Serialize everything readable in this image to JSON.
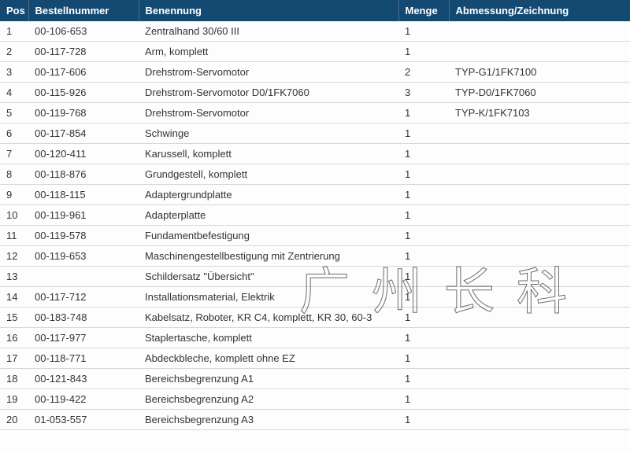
{
  "watermark": "广州长科",
  "columns": {
    "pos": "Pos",
    "bestellnummer": "Bestellnummer",
    "benennung": "Benennung",
    "menge": "Menge",
    "abmessung": "Abmessung/Zeichnung"
  },
  "rows": [
    {
      "pos": "1",
      "bestellnummer": "00-106-653",
      "benennung": "Zentralhand 30/60 III",
      "menge": "1",
      "abmessung": ""
    },
    {
      "pos": "2",
      "bestellnummer": "00-117-728",
      "benennung": "Arm, komplett",
      "menge": "1",
      "abmessung": ""
    },
    {
      "pos": "3",
      "bestellnummer": "00-117-606",
      "benennung": "Drehstrom-Servomotor",
      "menge": "2",
      "abmessung": "TYP-G1/1FK7100"
    },
    {
      "pos": "4",
      "bestellnummer": "00-115-926",
      "benennung": "Drehstrom-Servomotor D0/1FK7060",
      "menge": "3",
      "abmessung": "TYP-D0/1FK7060"
    },
    {
      "pos": "5",
      "bestellnummer": "00-119-768",
      "benennung": "Drehstrom-Servomotor",
      "menge": "1",
      "abmessung": "TYP-K/1FK7103"
    },
    {
      "pos": "6",
      "bestellnummer": "00-117-854",
      "benennung": "Schwinge",
      "menge": "1",
      "abmessung": ""
    },
    {
      "pos": "7",
      "bestellnummer": "00-120-411",
      "benennung": "Karussell, komplett",
      "menge": "1",
      "abmessung": ""
    },
    {
      "pos": "8",
      "bestellnummer": "00-118-876",
      "benennung": "Grundgestell, komplett",
      "menge": "1",
      "abmessung": ""
    },
    {
      "pos": "9",
      "bestellnummer": "00-118-115",
      "benennung": "Adaptergrundplatte",
      "menge": "1",
      "abmessung": ""
    },
    {
      "pos": "10",
      "bestellnummer": "00-119-961",
      "benennung": "Adapterplatte",
      "menge": "1",
      "abmessung": ""
    },
    {
      "pos": "11",
      "bestellnummer": "00-119-578",
      "benennung": "Fundamentbefestigung",
      "menge": "1",
      "abmessung": ""
    },
    {
      "pos": "12",
      "bestellnummer": "00-119-653",
      "benennung": "Maschinengestellbestigung mit Zentrierung",
      "menge": "1",
      "abmessung": ""
    },
    {
      "pos": "13",
      "bestellnummer": "",
      "benennung": "Schildersatz \"Übersicht\"",
      "menge": "1",
      "abmessung": ""
    },
    {
      "pos": "14",
      "bestellnummer": "00-117-712",
      "benennung": "Installationsmaterial, Elektrik",
      "menge": "1",
      "abmessung": ""
    },
    {
      "pos": "15",
      "bestellnummer": "00-183-748",
      "benennung": "Kabelsatz, Roboter, KR C4, komplett, KR 30, 60-3",
      "menge": "1",
      "abmessung": ""
    },
    {
      "pos": "16",
      "bestellnummer": "00-117-977",
      "benennung": "Staplertasche, komplett",
      "menge": "1",
      "abmessung": ""
    },
    {
      "pos": "17",
      "bestellnummer": "00-118-771",
      "benennung": "Abdeckbleche, komplett ohne EZ",
      "menge": "1",
      "abmessung": ""
    },
    {
      "pos": "18",
      "bestellnummer": "00-121-843",
      "benennung": "Bereichsbegrenzung A1",
      "menge": "1",
      "abmessung": ""
    },
    {
      "pos": "19",
      "bestellnummer": "00-119-422",
      "benennung": "Bereichsbegrenzung A2",
      "menge": "1",
      "abmessung": ""
    },
    {
      "pos": "20",
      "bestellnummer": "01-053-557",
      "benennung": "Bereichsbegrenzung A3",
      "menge": "1",
      "abmessung": ""
    }
  ]
}
